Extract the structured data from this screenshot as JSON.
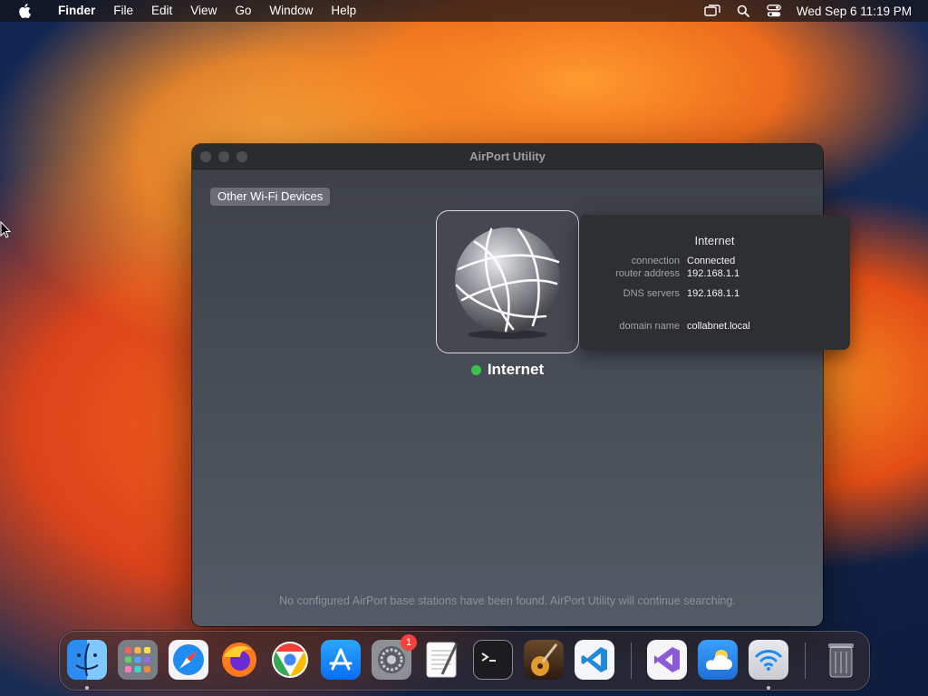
{
  "menubar": {
    "app_name": "Finder",
    "menus": [
      "File",
      "Edit",
      "View",
      "Go",
      "Window",
      "Help"
    ],
    "clock": "Wed Sep 6  11:19 PM",
    "status_icons": [
      "screen-mirroring-icon",
      "search-icon",
      "control-center-icon"
    ]
  },
  "window": {
    "title": "AirPort Utility",
    "other_devices_label": "Other Wi-Fi Devices",
    "internet_label": "Internet",
    "internet_status_color": "#3cc14a",
    "search_message": "No configured AirPort base stations have been found. AirPort Utility will continue searching."
  },
  "popover": {
    "title": "Internet",
    "rows": [
      {
        "key": "connection",
        "value": "Connected"
      },
      {
        "key": "router address",
        "value": "192.168.1.1"
      },
      {
        "key": "DNS servers",
        "value": "192.168.1.1"
      },
      {
        "key": "domain name",
        "value": "collabnet.local"
      }
    ]
  },
  "dock": {
    "apps": [
      {
        "name": "Finder",
        "icon": "finder-icon",
        "running": true
      },
      {
        "name": "Launchpad",
        "icon": "launchpad-icon",
        "running": false
      },
      {
        "name": "Safari",
        "icon": "safari-icon",
        "running": false
      },
      {
        "name": "Firefox",
        "icon": "firefox-icon",
        "running": false
      },
      {
        "name": "Chrome",
        "icon": "chrome-icon",
        "running": false
      },
      {
        "name": "App Store",
        "icon": "app-store-icon",
        "running": false
      },
      {
        "name": "System Settings",
        "icon": "system-settings-icon",
        "running": false,
        "badge": "1"
      },
      {
        "name": "TextEdit",
        "icon": "textedit-icon",
        "running": false
      },
      {
        "name": "Terminal",
        "icon": "terminal-icon",
        "running": false
      },
      {
        "name": "GarageBand",
        "icon": "garageband-icon",
        "running": false
      },
      {
        "name": "VS Code",
        "icon": "vscode-icon",
        "running": false
      },
      {
        "name": "Visual Studio",
        "icon": "visual-studio-icon",
        "running": false
      },
      {
        "name": "Weather",
        "icon": "weather-icon",
        "running": false
      },
      {
        "name": "AirPort Utility",
        "icon": "airport-utility-icon",
        "running": true
      },
      {
        "name": "Trash",
        "icon": "trash-icon",
        "running": false
      }
    ]
  }
}
